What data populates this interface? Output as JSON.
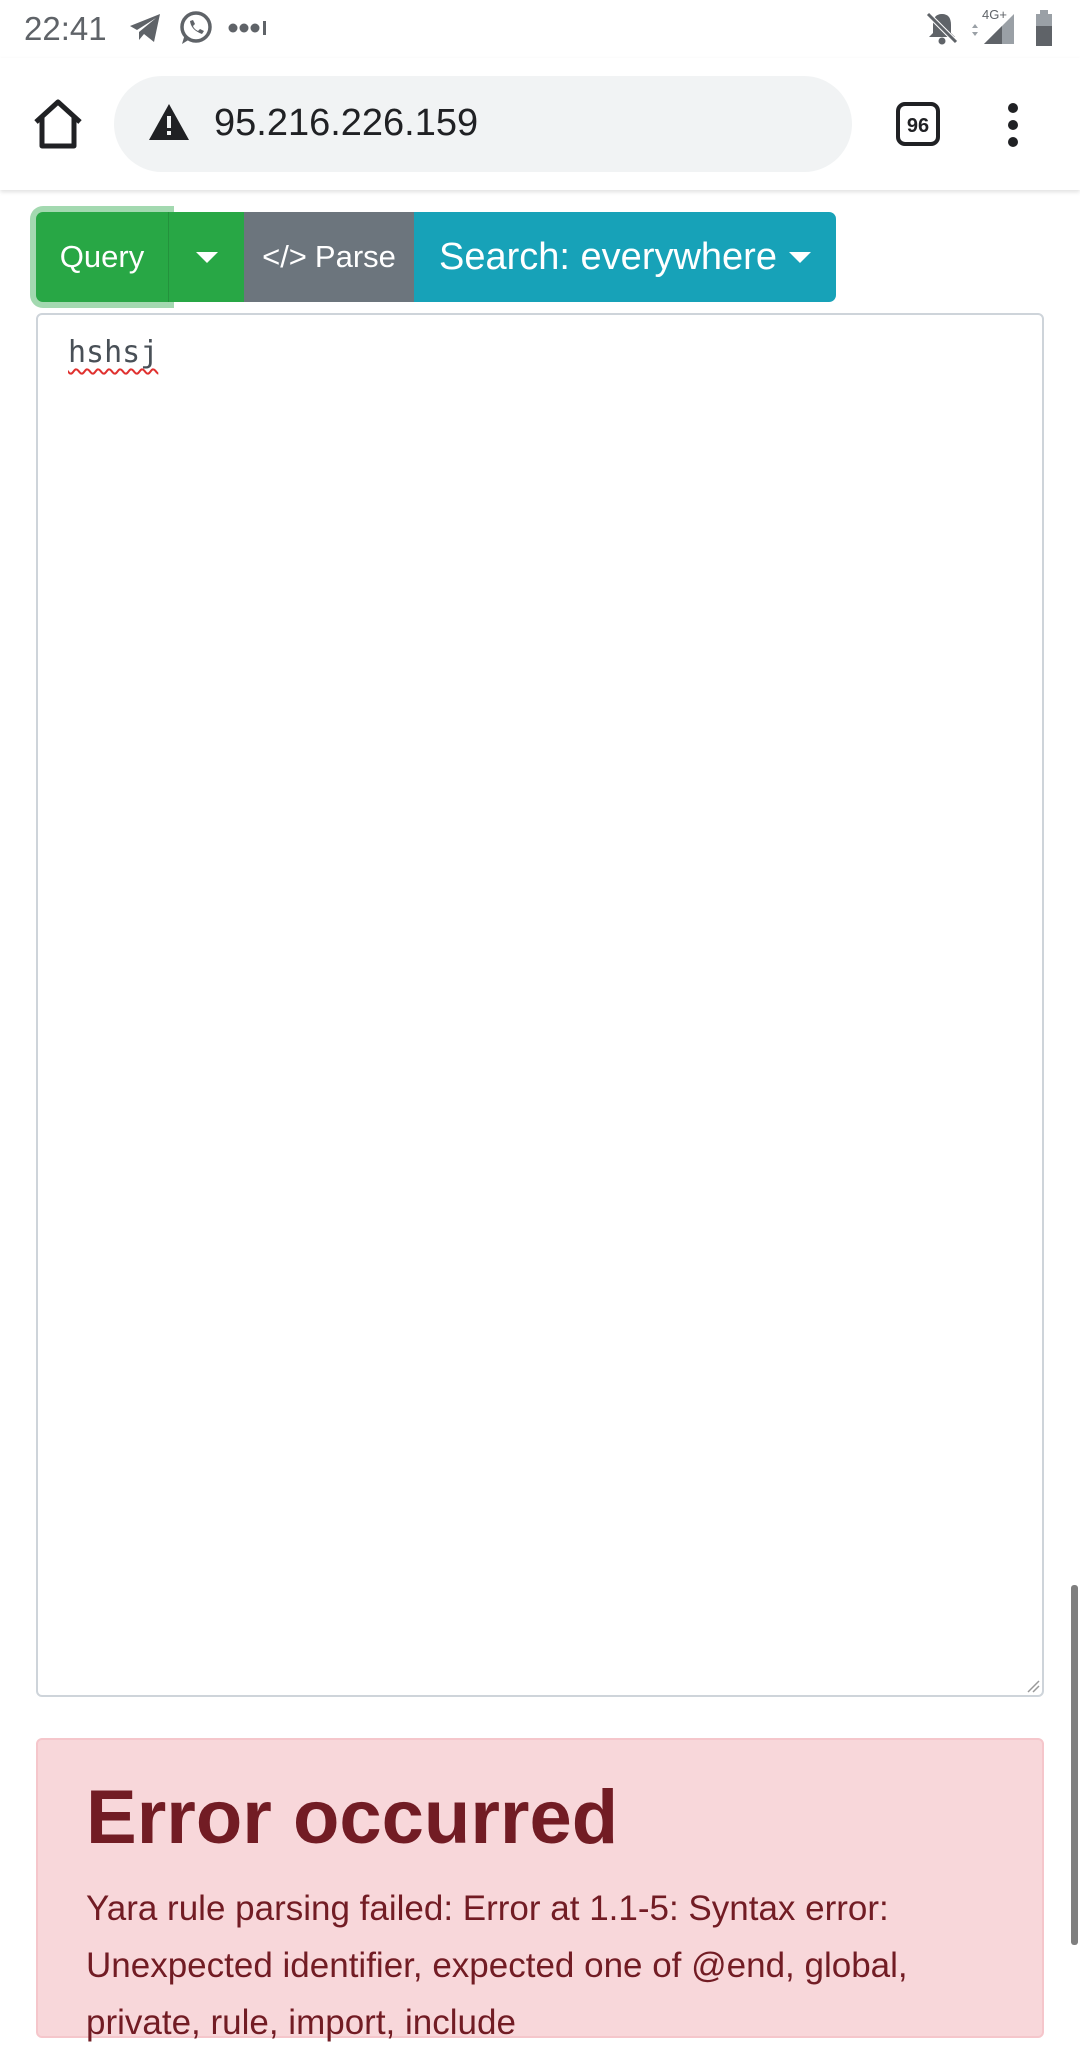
{
  "status_bar": {
    "time": "22:41",
    "icons": [
      "telegram-icon",
      "whatsapp-icon",
      "more-dots-icon",
      "bell-off-icon",
      "network-4g-icon",
      "signal-icon",
      "battery-icon"
    ],
    "network_label": "4G+"
  },
  "browser": {
    "url": "95.216.226.159",
    "tab_count": "96",
    "security_icon": "warning-triangle-icon"
  },
  "toolbar": {
    "query_label": "Query",
    "parse_label": "Parse",
    "parse_icon": "</>",
    "search_label": "Search: everywhere"
  },
  "editor": {
    "value": "hshsj"
  },
  "error": {
    "title": "Error occurred",
    "message": "Yara rule parsing failed: Error at 1.1-5: Syntax error: Unexpected identifier, expected one of @end, global, private, rule, import, include"
  },
  "colors": {
    "query_green": "#28a745",
    "parse_gray": "#6c757d",
    "search_teal": "#17a2b8",
    "error_bg": "#f8d7da",
    "error_text": "#721c24"
  }
}
